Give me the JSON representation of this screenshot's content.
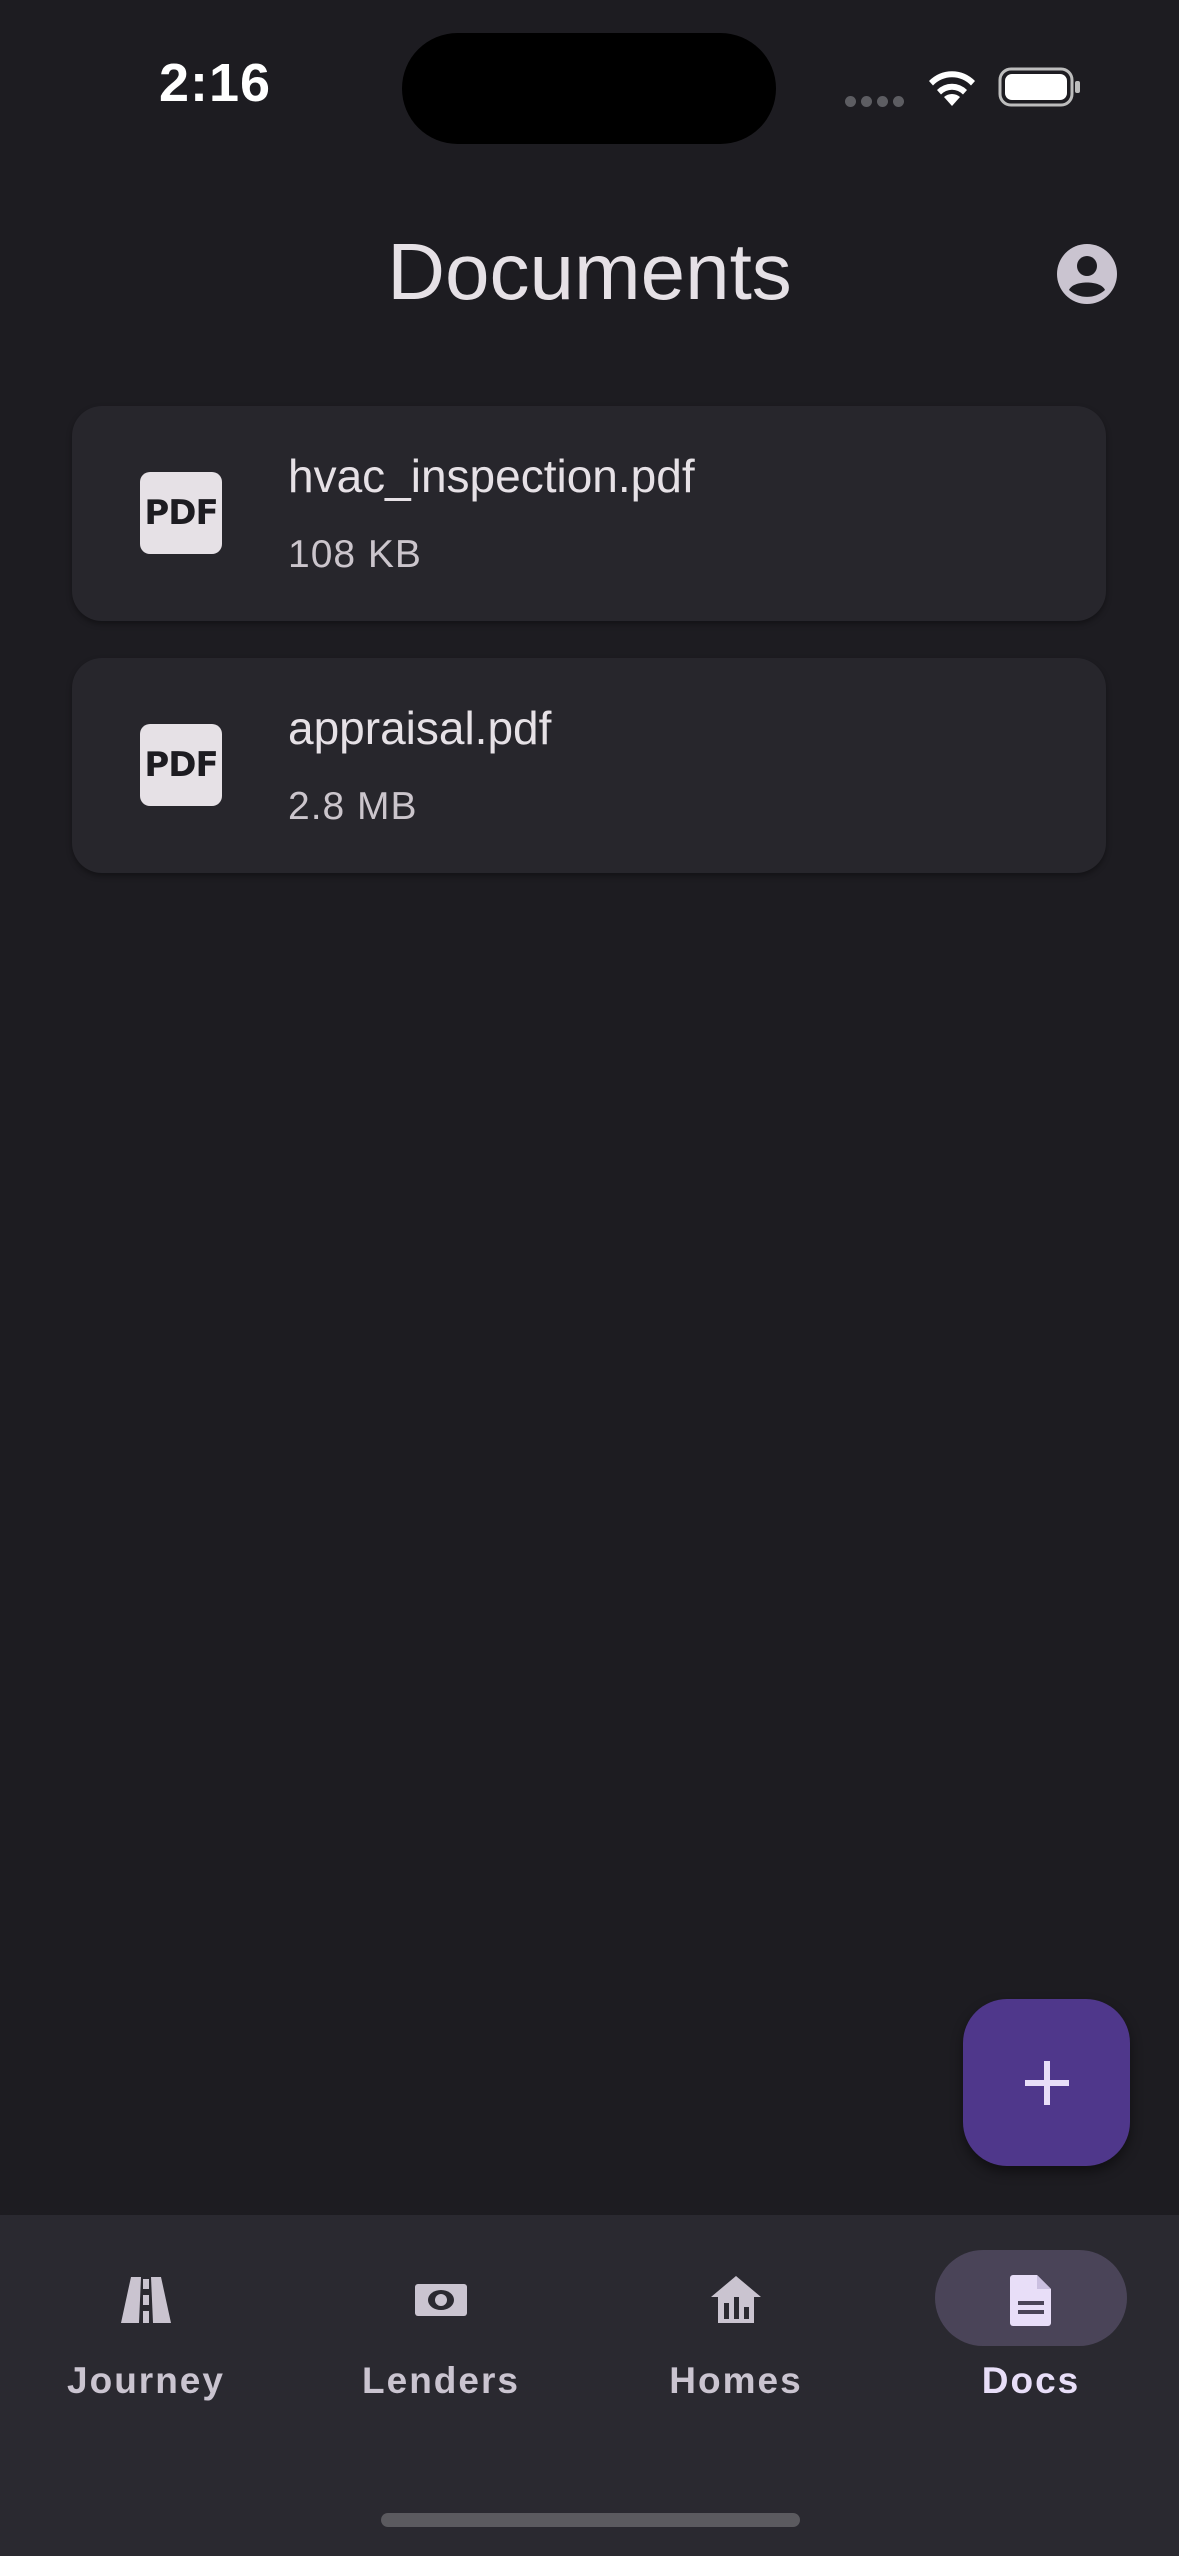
{
  "status_bar": {
    "time": "2:16"
  },
  "header": {
    "title": "Documents",
    "account_icon": "account-circle-icon"
  },
  "documents": [
    {
      "name": "hvac_inspection.pdf",
      "size": "108 KB",
      "icon": "pdf-file-icon",
      "badge": "PDF"
    },
    {
      "name": "appraisal.pdf",
      "size": "2.8 MB",
      "icon": "pdf-file-icon",
      "badge": "PDF"
    }
  ],
  "fab": {
    "icon": "plus-icon"
  },
  "nav": {
    "items": [
      {
        "label": "Journey",
        "icon": "road-icon",
        "active": false
      },
      {
        "label": "Lenders",
        "icon": "payments-icon",
        "active": false
      },
      {
        "label": "Homes",
        "icon": "home-icon",
        "active": false
      },
      {
        "label": "Docs",
        "icon": "document-icon",
        "active": true
      }
    ]
  },
  "colors": {
    "background": "#1d1c21",
    "card": "#27262c",
    "fab": "#4f378b",
    "nav_bar": "#2a2930",
    "nav_active_indicator": "#4a4458"
  }
}
